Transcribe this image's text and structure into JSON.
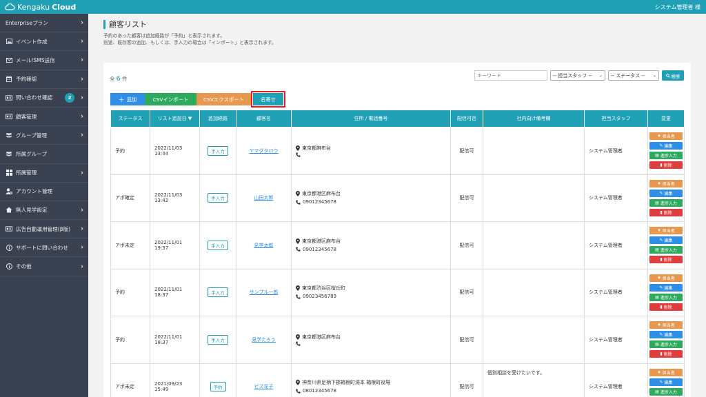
{
  "header": {
    "logo_part1": "Kengaku",
    "logo_part2": "Cloud",
    "user": "システム管理者 様"
  },
  "sidebar": {
    "items": [
      {
        "label": "Enterpriseプラン",
        "icon": "none",
        "chevron": true
      },
      {
        "label": "イベント作成",
        "icon": "image-icon",
        "chevron": true
      },
      {
        "label": "メール/SMS送信",
        "icon": "mail-icon",
        "chevron": true
      },
      {
        "label": "予約確認",
        "icon": "calendar-icon",
        "chevron": true
      },
      {
        "label": "問い合わせ確認",
        "icon": "id-card-icon",
        "chevron": true,
        "badge": "2"
      },
      {
        "label": "顧客管理",
        "icon": "id-card-icon",
        "chevron": true
      },
      {
        "label": "グループ管理",
        "icon": "users-icon",
        "chevron": true
      },
      {
        "label": "所属グループ",
        "icon": "users-icon",
        "chevron": false
      },
      {
        "label": "所属管理",
        "icon": "grid-icon",
        "chevron": true
      },
      {
        "label": "アカウント管理",
        "icon": "user-gear-icon",
        "chevron": false
      },
      {
        "label": "無人見学設定",
        "icon": "home-icon",
        "chevron": true
      },
      {
        "label": "広告自動運用管理(β版)",
        "icon": "id-card-icon",
        "chevron": true
      },
      {
        "label": "サポートに問い合わせ",
        "icon": "info-icon",
        "chevron": true
      },
      {
        "label": "その他",
        "icon": "info-icon",
        "chevron": true
      }
    ]
  },
  "page": {
    "title": "顧客リスト",
    "desc1": "予約のあった顧客は追加経路が「予約」と表示されます。",
    "desc2": "別途、既存客の追加、もしくは、手入力の場合は「インポート」と表示されます。"
  },
  "count": {
    "prefix": "全",
    "value": "6",
    "suffix": "件"
  },
  "filters": {
    "keyword_placeholder": "キーワード",
    "staff_select": "-- 担当スタッフ --",
    "status_select": "-- ステータス --",
    "search_label": "検索"
  },
  "actions": {
    "add": "追加",
    "csv_import": "CSVインポート",
    "csv_export": "CSVエクスポート",
    "nayose": "名寄せ"
  },
  "table": {
    "headers": {
      "status": "ステータス",
      "added": "リスト追加日",
      "route": "追加経路",
      "name": "顧客名",
      "address": "住所 / 電話番号",
      "delivery": "配信可否",
      "note": "社内向け備考欄",
      "staff": "担当スタッフ",
      "change": "変更"
    },
    "sort_arrow": "▼",
    "row_buttons": {
      "assign": "担当者",
      "edit": "編集",
      "progress": "進捗入力",
      "delete": "削除"
    },
    "rows": [
      {
        "status": "予約",
        "date": "2022/11/03",
        "time": "13:44",
        "route": "手入力",
        "name": "ヤマダタロウ",
        "address": "東京都麻布台",
        "phone": "",
        "delivery": "配信可",
        "note": "",
        "staff": "システム管理者"
      },
      {
        "status": "アポ確定",
        "date": "2022/11/03",
        "time": "13:42",
        "route": "手入力",
        "name": "山田太郎",
        "address": "東京都港区麻布台",
        "phone": "09012345678",
        "delivery": "配信可",
        "note": "",
        "staff": "システム管理者"
      },
      {
        "status": "アポ未定",
        "date": "2022/11/01",
        "time": "19:37",
        "route": "手入力",
        "name": "見学太郎",
        "address": "東京都港区麻布台",
        "phone": "09012345678",
        "delivery": "配信可",
        "note": "",
        "staff": "システム管理者"
      },
      {
        "status": "予約",
        "date": "2022/11/01",
        "time": "18:37",
        "route": "手入力",
        "name": "サンプル一郎",
        "address": "東京都渋谷区桜丘町",
        "phone": "09023456789",
        "delivery": "配信可",
        "note": "",
        "staff": "システム管理者"
      },
      {
        "status": "予約",
        "date": "2022/11/01",
        "time": "18:37",
        "route": "手入力",
        "name": "見学たろう",
        "address": "東京都港区麻布台",
        "phone": "",
        "delivery": "配信可",
        "note": "",
        "staff": "システム管理者"
      },
      {
        "status": "アポ未定",
        "date": "2021/09/23",
        "time": "15:49",
        "route": "予約",
        "name": "ビズ花子",
        "address": "神奈川県足柄下郡箱根町湯本 箱根町役場",
        "phone": "08012345678",
        "delivery": "配信可",
        "note": "個別相談を受けたいです。",
        "staff": "システム管理者"
      }
    ]
  }
}
